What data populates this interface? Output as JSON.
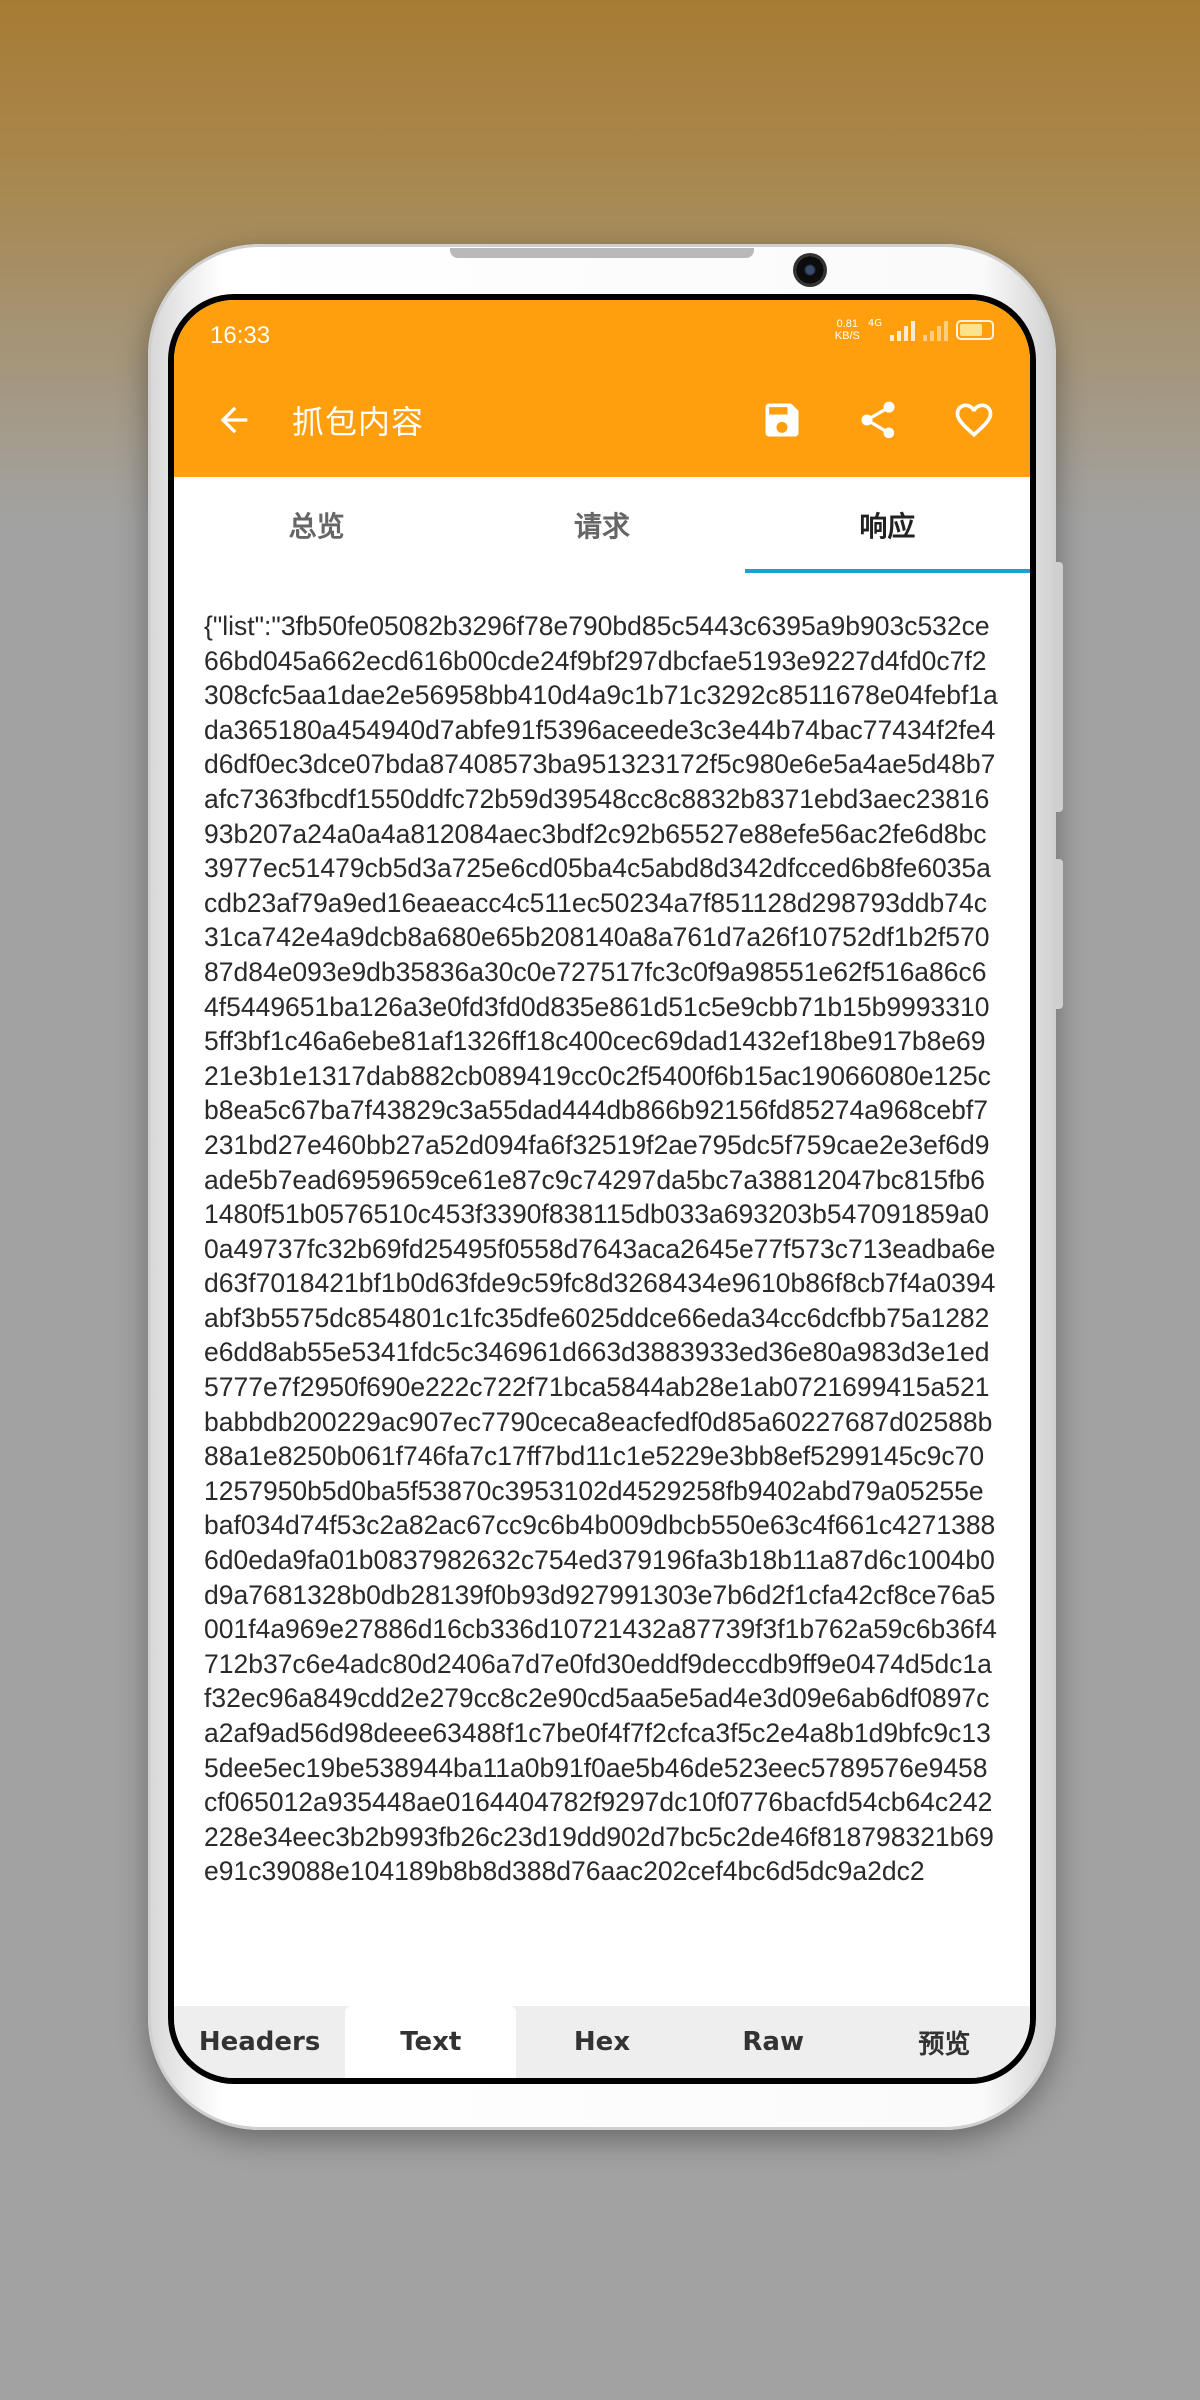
{
  "status_bar": {
    "time": "16:33",
    "net_speed_value": "0.81",
    "net_speed_unit": "KB/S",
    "network": "4G"
  },
  "app_bar": {
    "title": "抓包内容",
    "back_icon": "arrow-left-icon",
    "actions": [
      "save-icon",
      "share-icon",
      "heart-icon"
    ],
    "color": "#ff9f0e"
  },
  "tabs": [
    {
      "label": "总览",
      "active": false
    },
    {
      "label": "请求",
      "active": false
    },
    {
      "label": "响应",
      "active": true
    }
  ],
  "tab_indicator_color": "#1e9ed6",
  "response_text": "{\"list\":\"3fb50fe05082b3296f78e790bd85c5443c6395a9b903c532ce66bd045a662ecd616b00cde24f9bf297dbcfae5193e9227d4fd0c7f2308cfc5aa1dae2e56958bb410d4a9c1b71c3292c8511678e04febf1ada365180a454940d7abfe91f5396aceede3c3e44b74bac77434f2fe4d6df0ec3dce07bda87408573ba951323172f5c980e6e5a4ae5d48b7afc7363fbcdf1550ddfc72b59d39548cc8c8832b8371ebd3aec2381693b207a24a0a4a812084aec3bdf2c92b65527e88efe56ac2fe6d8bc3977ec51479cb5d3a725e6cd05ba4c5abd8d342dfcced6b8fe6035acdb23af79a9ed16eaeacc4c511ec50234a7f851128d298793ddb74c31ca742e4a9dcb8a680e65b208140a8a761d7a26f10752df1b2f57087d84e093e9db35836a30c0e727517fc3c0f9a98551e62f516a86c64f5449651ba126a3e0fd3fd0d835e861d51c5e9cbb71b15b99933105ff3bf1c46a6ebe81af1326ff18c400cec69dad1432ef18be917b8e6921e3b1e1317dab882cb089419cc0c2f5400f6b15ac19066080e125cb8ea5c67ba7f43829c3a55dad444db866b92156fd85274a968cebf7231bd27e460bb27a52d094fa6f32519f2ae795dc5f759cae2e3ef6d9ade5b7ead6959659ce61e87c9c74297da5bc7a38812047bc815fb61480f51b0576510c453f3390f838115db033a693203b547091859a00a49737fc32b69fd25495f0558d7643aca2645e77f573c713eadba6ed63f7018421bf1b0d63fde9c59fc8d3268434e9610b86f8cb7f4a0394abf3b5575dc854801c1fc35dfe6025ddce66eda34cc6dcfbb75a1282e6dd8ab55e5341fdc5c346961d663d3883933ed36e80a983d3e1ed5777e7f2950f690e222c722f71bca5844ab28e1ab0721699415a521babbdb200229ac907ec7790ceca8eacfedf0d85a60227687d02588b88a1e8250b061f746fa7c17ff7bd11c1e5229e3bb8ef5299145c9c701257950b5d0ba5f53870c3953102d4529258fb9402abd79a05255ebaf034d74f53c2a82ac67cc9c6b4b009dbcb550e63c4f661c42713886d0eda9fa01b0837982632c754ed379196fa3b18b11a87d6c1004b0d9a7681328b0db28139f0b93d927991303e7b6d2f1cfa42cf8ce76a5001f4a969e27886d16cb336d10721432a87739f3f1b762a59c6b36f4712b37c6e4adc80d2406a7d7e0fd30eddf9deccdb9ff9e0474d5dc1af32ec96a849cdd2e279cc8c2e90cd5aa5e5ad4e3d09e6ab6df0897ca2af9ad56d98deee63488f1c7be0f4f7f2cfca3f5c2e4a8b1d9bfc9c135dee5ec19be538944ba11a0b91f0ae5b46de523eec5789576e9458cf065012a935448ae0164404782f9297dc10f0776bacfd54cb64c242228e34eec3b2b993fb26c23d19dd902d7bc5c2de46f818798321b69e91c39088e104189b8b8d388d76aac202cef4bc6d5dc9a2dc2",
  "bottom_tabs": [
    {
      "label": "Headers",
      "active": false
    },
    {
      "label": "Text",
      "active": true
    },
    {
      "label": "Hex",
      "active": false
    },
    {
      "label": "Raw",
      "active": false
    },
    {
      "label": "预览",
      "active": false
    }
  ]
}
